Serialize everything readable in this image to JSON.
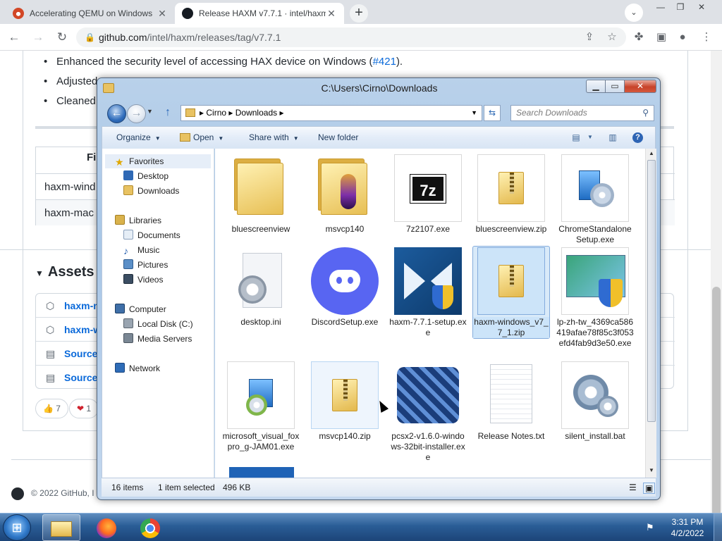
{
  "browser": {
    "tabs": [
      {
        "title": "Accelerating QEMU on Windows",
        "active": false
      },
      {
        "title": "Release HAXM v7.7.1 · intel/haxm",
        "active": true
      }
    ],
    "new_tab": "+",
    "url_host": "github.com",
    "url_path": "/intel/haxm/releases/tag/v7.7.1"
  },
  "github": {
    "bullets": [
      {
        "text": "Enhanced the security level of accessing HAX device on Windows (",
        "link": "#421",
        "after": ")."
      },
      {
        "text": "Adjusted",
        "link": "",
        "after": ""
      },
      {
        "text": "Cleaned",
        "link": "",
        "after": ""
      }
    ],
    "table_header": "Fi",
    "table_rows": [
      "haxm-wind",
      "haxm-mac"
    ],
    "assets_title": "Assets",
    "assets": [
      "haxm-m",
      "haxm-w",
      "Source",
      "Source"
    ],
    "reactions": [
      {
        "emoji": "👍",
        "count": "7"
      },
      {
        "emoji": "❤",
        "count": "1"
      }
    ],
    "footer": "© 2022 GitHub, I"
  },
  "explorer": {
    "title": "C:\\Users\\Cirno\\Downloads",
    "breadcrumb": [
      "Cirno",
      "Downloads"
    ],
    "search_placeholder": "Search Downloads",
    "commands": {
      "organize": "Organize",
      "open": "Open",
      "share_with": "Share with",
      "new_folder": "New folder"
    },
    "nav": {
      "favorites": "Favorites",
      "favorites_items": [
        "Desktop",
        "Downloads"
      ],
      "libraries": "Libraries",
      "libraries_items": [
        "Documents",
        "Music",
        "Pictures",
        "Videos"
      ],
      "computer": "Computer",
      "computer_items": [
        "Local Disk (C:)",
        "Media Servers"
      ],
      "network": "Network"
    },
    "files": [
      {
        "name": "bluescreenview",
        "icon": "folder-icon"
      },
      {
        "name": "msvcp140",
        "icon": "folder-icon"
      },
      {
        "name": "7z2107.exe",
        "icon": "7zip-installer-icon"
      },
      {
        "name": "bluescreenview.zip",
        "icon": "zip-folder-icon"
      },
      {
        "name": "ChromeStandaloneSetup.exe",
        "icon": "setup-disc-icon"
      },
      {
        "name": "desktop.ini",
        "icon": "settings-file-icon"
      },
      {
        "name": "DiscordSetup.exe",
        "icon": "discord-icon"
      },
      {
        "name": "haxm-7.7.1-setup.exe",
        "icon": "haxm-installer-icon"
      },
      {
        "name": "haxm-windows_v7_7_1.zip",
        "icon": "zip-folder-icon",
        "selected": true
      },
      {
        "name": "lp-zh-tw_4369ca586419afae78f85c3f053efd4fab9d3e50.exe",
        "icon": "shield-installer-icon"
      },
      {
        "name": "microsoft_visual_foxpro_g-JAM01.exe",
        "icon": "setup-disc-icon"
      },
      {
        "name": "msvcp140.zip",
        "icon": "zip-folder-icon",
        "hover": true
      },
      {
        "name": "pcsx2-v1.6.0-windows-32bit-installer.exe",
        "icon": "pcsx2-icon"
      },
      {
        "name": "Release Notes.txt",
        "icon": "text-file-icon"
      },
      {
        "name": "silent_install.bat",
        "icon": "batch-file-icon"
      }
    ],
    "status_count": "16 items",
    "status_selected": "1 item selected",
    "status_size": "496 KB"
  },
  "taskbar": {
    "time": "3:31 PM",
    "date": "4/2/2022"
  },
  "colors": {
    "github_link": "#0969da",
    "explorer_selection": "#cce4f9",
    "discord_blurple": "#5865f2",
    "taskbar": "#2a5d96"
  }
}
